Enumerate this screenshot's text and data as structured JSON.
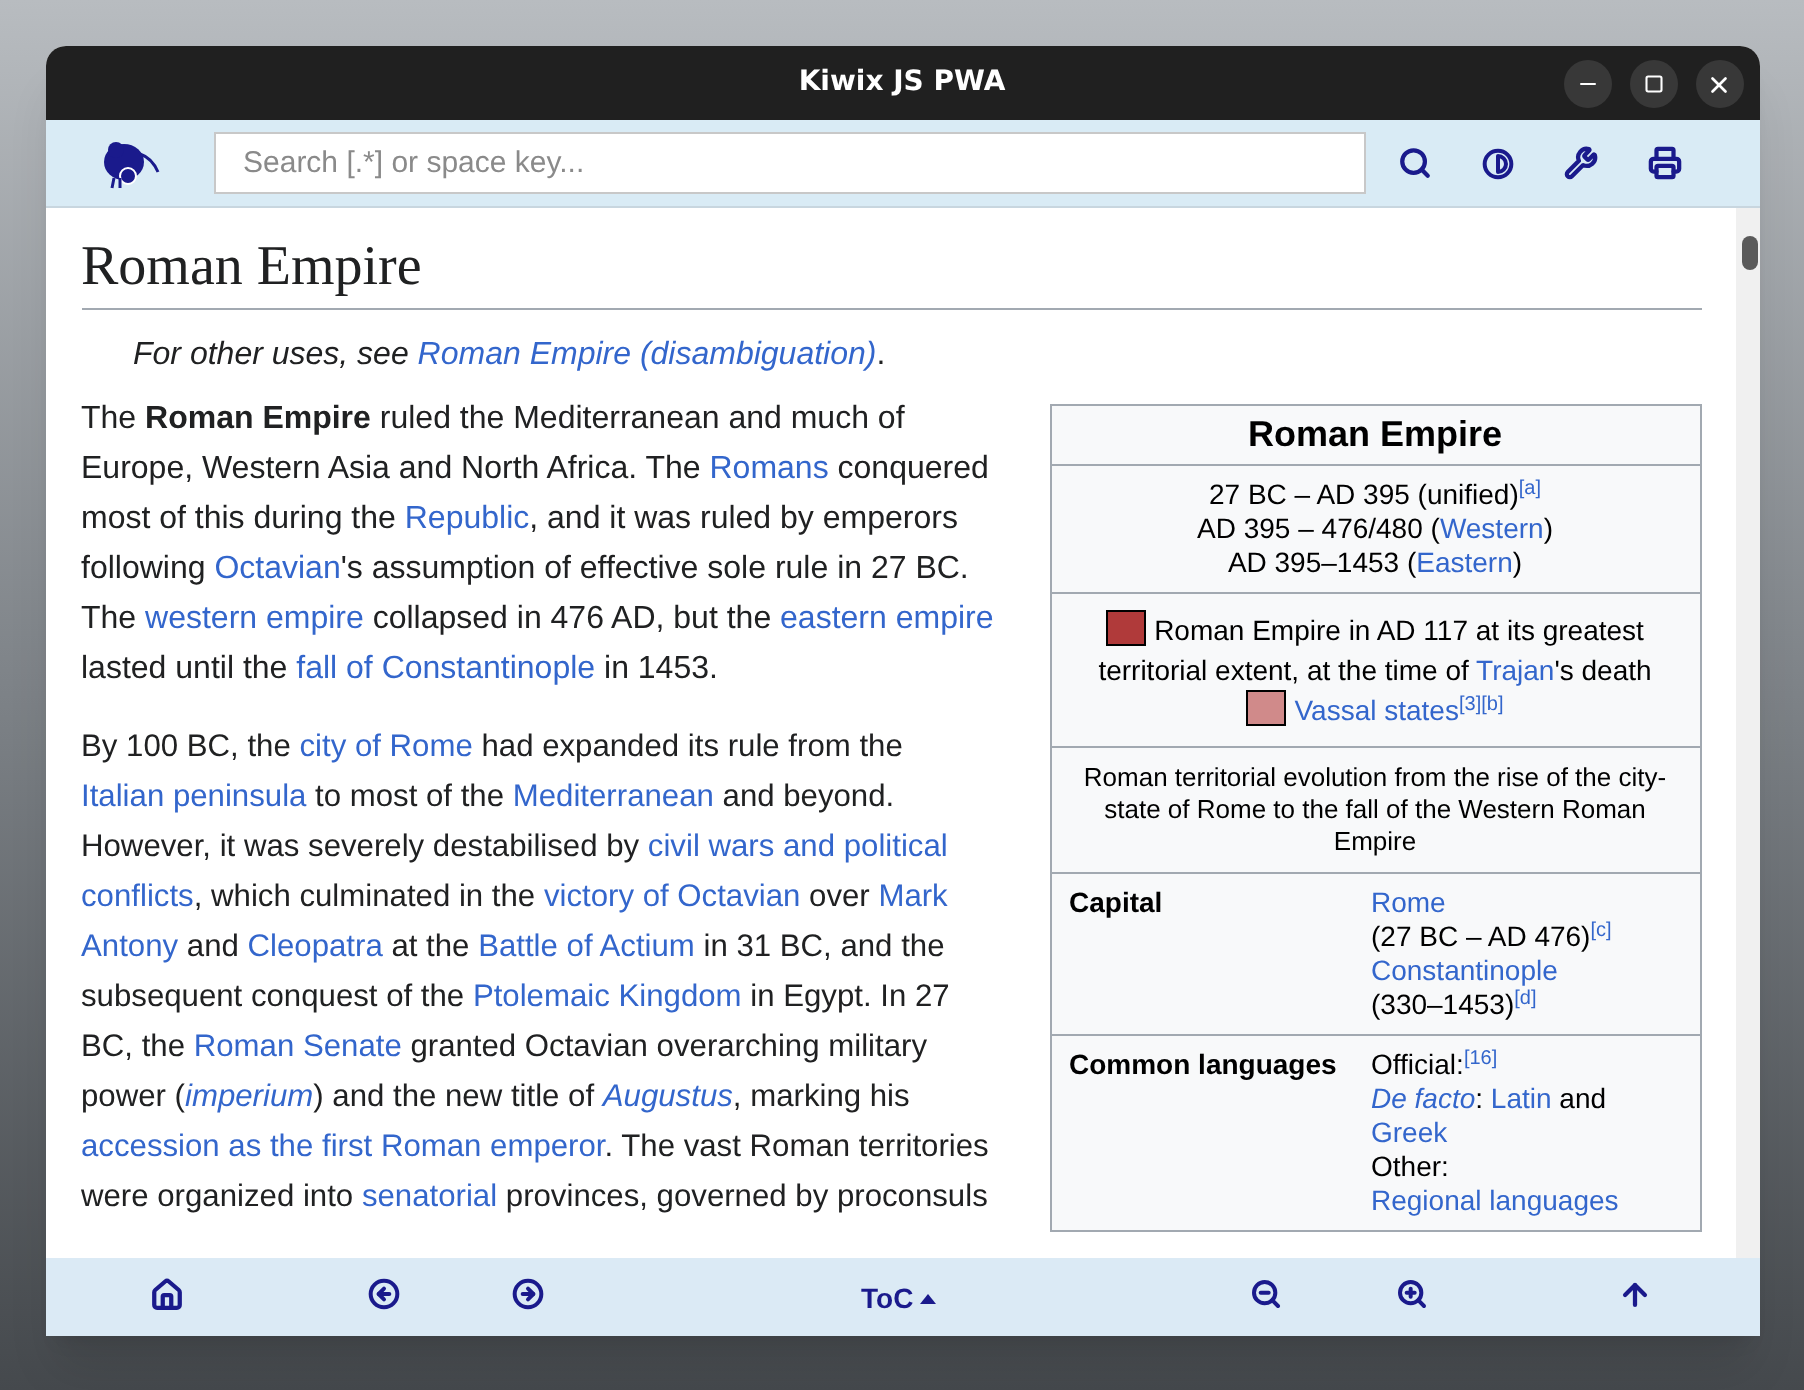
{
  "window": {
    "title": "Kiwix JS PWA"
  },
  "toolbar": {
    "search": {
      "placeholder": "Search [.*] or space key..."
    }
  },
  "article": {
    "title": "Roman Empire",
    "hatnote": [
      {
        "kind": "italic",
        "text": "For other uses, see "
      },
      {
        "kind": "italic_link",
        "text": "Roman Empire (disambiguation)"
      },
      {
        "kind": "plain",
        "text": "."
      }
    ],
    "paragraphs": [
      [
        {
          "kind": "plain",
          "text": "The "
        },
        {
          "kind": "bold",
          "text": "Roman Empire"
        },
        {
          "kind": "plain",
          "text": " ruled the Mediterranean and much of Europe, Western Asia and North Africa. The "
        },
        {
          "kind": "link",
          "text": "Romans"
        },
        {
          "kind": "plain",
          "text": " conquered most of this during the "
        },
        {
          "kind": "link",
          "text": "Republic"
        },
        {
          "kind": "plain",
          "text": ", and it was ruled by emperors following "
        },
        {
          "kind": "link",
          "text": "Octavian"
        },
        {
          "kind": "plain",
          "text": "'s assumption of effective sole rule in 27 BC. The "
        },
        {
          "kind": "link",
          "text": "western empire"
        },
        {
          "kind": "plain",
          "text": " collapsed in 476 AD, but the "
        },
        {
          "kind": "link",
          "text": "eastern empire"
        },
        {
          "kind": "plain",
          "text": " lasted until the "
        },
        {
          "kind": "link",
          "text": "fall of Constantinople"
        },
        {
          "kind": "plain",
          "text": " in 1453."
        }
      ],
      [
        {
          "kind": "plain",
          "text": "By 100 BC, the "
        },
        {
          "kind": "link",
          "text": "city of Rome"
        },
        {
          "kind": "plain",
          "text": " had expanded its rule from the "
        },
        {
          "kind": "link",
          "text": "Italian peninsula"
        },
        {
          "kind": "plain",
          "text": " to most of the "
        },
        {
          "kind": "link",
          "text": "Mediterranean"
        },
        {
          "kind": "plain",
          "text": " and beyond. However, it was severely destabilised by "
        },
        {
          "kind": "link",
          "text": "civil wars and political",
          "space_after": true
        },
        {
          "kind": "link",
          "text": "conflicts"
        },
        {
          "kind": "plain",
          "text": ", which culminated in the "
        },
        {
          "kind": "link",
          "text": "victory of Octavian"
        },
        {
          "kind": "plain",
          "text": " over "
        },
        {
          "kind": "link",
          "text": "Mark",
          "space_after": true
        },
        {
          "kind": "link",
          "text": "Antony"
        },
        {
          "kind": "plain",
          "text": " and "
        },
        {
          "kind": "link",
          "text": "Cleopatra"
        },
        {
          "kind": "plain",
          "text": " at the "
        },
        {
          "kind": "link",
          "text": "Battle of Actium"
        },
        {
          "kind": "plain",
          "text": " in 31 BC, and the subsequent conquest of the "
        },
        {
          "kind": "link",
          "text": "Ptolemaic Kingdom"
        },
        {
          "kind": "plain",
          "text": " in Egypt. In 27 BC, the "
        },
        {
          "kind": "link",
          "text": "Roman Senate"
        },
        {
          "kind": "plain",
          "text": " granted Octavian overarching military power ("
        },
        {
          "kind": "italic_link",
          "text": "imperium"
        },
        {
          "kind": "plain",
          "text": ") and the new title of "
        },
        {
          "kind": "italic_link",
          "text": "Augustus"
        },
        {
          "kind": "plain",
          "text": ", marking his "
        },
        {
          "kind": "link",
          "text": "accession as the first Roman emperor"
        },
        {
          "kind": "plain",
          "text": ". The vast Roman territories were organized into "
        },
        {
          "kind": "link",
          "text": "senatorial"
        },
        {
          "kind": "plain",
          "text": " provinces, governed by proconsuls"
        }
      ]
    ],
    "infobox": {
      "title": "Roman Empire",
      "dates": [
        [
          {
            "kind": "plain",
            "text": "27 BC – AD 395 (unified)"
          },
          {
            "kind": "ref",
            "text": "[a]"
          }
        ],
        [
          {
            "kind": "plain",
            "text": "AD 395 – 476/480 ("
          },
          {
            "kind": "link",
            "text": "Western"
          },
          {
            "kind": "plain",
            "text": ")"
          }
        ],
        [
          {
            "kind": "plain",
            "text": "AD 395–1453 ("
          },
          {
            "kind": "link",
            "text": "Eastern"
          },
          {
            "kind": "plain",
            "text": ")"
          }
        ]
      ],
      "legend": [
        [
          {
            "kind": "swatch",
            "color": "#b03a3a"
          },
          {
            "kind": "plain",
            "text": "Roman Empire in AD 117 at its greatest territorial extent, at the time of "
          },
          {
            "kind": "link",
            "text": "Trajan"
          },
          {
            "kind": "plain",
            "text": "'s death"
          }
        ],
        [
          {
            "kind": "swatch",
            "color": "#d08a8a"
          },
          {
            "kind": "link",
            "text": "Vassal states"
          },
          {
            "kind": "ref",
            "text": "[3]"
          },
          {
            "kind": "ref",
            "text": "[b]"
          }
        ]
      ],
      "caption": "Roman territorial evolution from the rise of the city-state of Rome to the fall of the Western Roman Empire",
      "rows": [
        {
          "label": "Capital",
          "lines": [
            [
              {
                "kind": "link",
                "text": "Rome"
              }
            ],
            [
              {
                "kind": "plain",
                "text": "(27 BC – AD 476)"
              },
              {
                "kind": "ref",
                "text": "[c]"
              }
            ],
            [
              {
                "kind": "link",
                "text": "Constantinople"
              }
            ],
            [
              {
                "kind": "plain",
                "text": "(330–1453)"
              },
              {
                "kind": "ref",
                "text": "[d]"
              }
            ]
          ]
        },
        {
          "label": "Common languages",
          "lines": [
            [
              {
                "kind": "plain",
                "text": "Official:"
              },
              {
                "kind": "ref",
                "text": "[16]"
              }
            ],
            [
              {
                "kind": "italic_link",
                "text": "De facto"
              },
              {
                "kind": "plain",
                "text": ": "
              },
              {
                "kind": "link",
                "text": "Latin"
              },
              {
                "kind": "plain",
                "text": " and "
              },
              {
                "kind": "link",
                "text": "Greek"
              }
            ],
            [
              {
                "kind": "plain",
                "text": "Other:"
              }
            ],
            [
              {
                "kind": "link",
                "text": "Regional languages"
              }
            ]
          ]
        }
      ]
    }
  },
  "bottom_bar": {
    "toc_label": "ToC"
  }
}
